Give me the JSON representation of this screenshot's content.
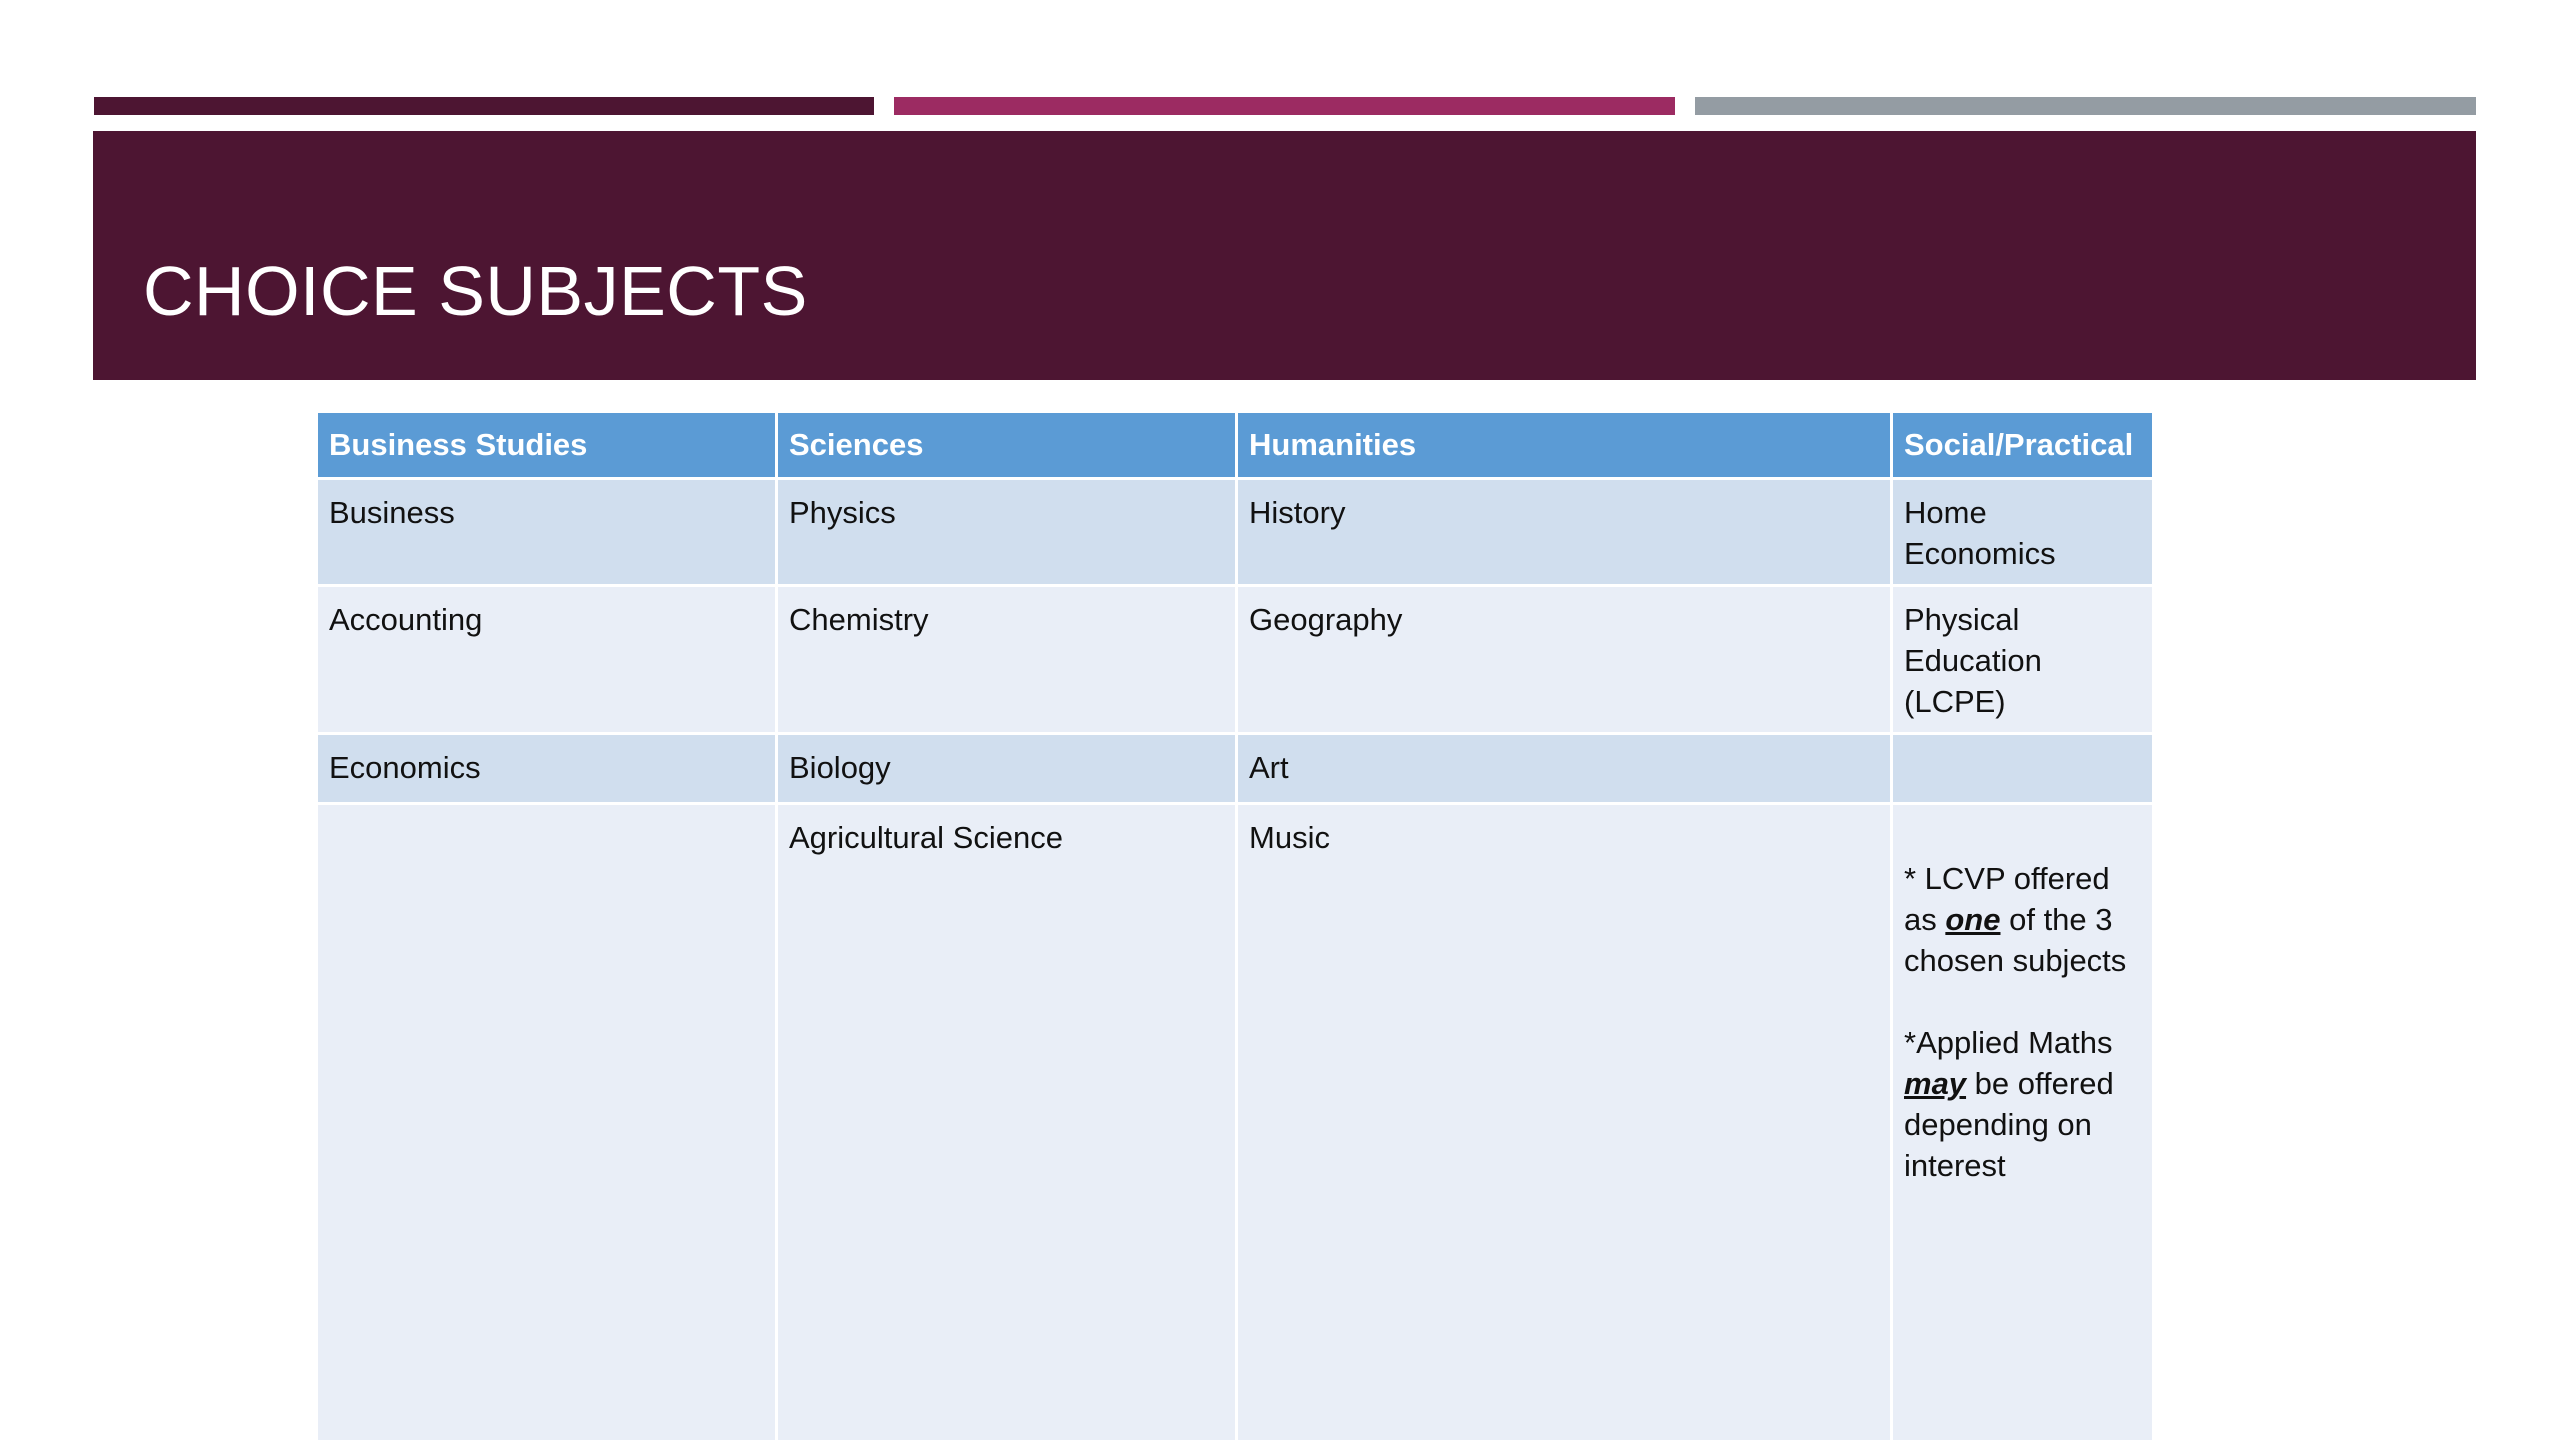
{
  "slide": {
    "title": "CHOICE SUBJECTS",
    "colors": {
      "title_band": "#4d1532",
      "accent_bar_1": "#4d1532",
      "accent_bar_2": "#9c2b62",
      "accent_bar_3": "#949ca3",
      "table_header": "#5b9bd5",
      "row_band_dark": "#d0deee",
      "row_band_light": "#e9eef7"
    }
  },
  "table": {
    "headers": [
      "Business Studies",
      "Sciences",
      "Humanities",
      "Social/Practical"
    ],
    "rows": [
      [
        "Business",
        "Physics",
        "History",
        "Home Economics"
      ],
      [
        "Accounting",
        "Chemistry",
        "Geography",
        "Physical Education (LCPE)"
      ],
      [
        "Economics",
        "Biology",
        "Art",
        ""
      ],
      [
        "",
        "Agricultural Science",
        "Music",
        ""
      ]
    ],
    "notes": {
      "lcvp_pre": "* LCVP offered as ",
      "lcvp_emphasis": "one",
      "lcvp_post": " of the 3 chosen subjects",
      "maths_pre": "*Applied Maths ",
      "maths_emphasis": "may",
      "maths_post": " be offered depending on interest"
    }
  }
}
